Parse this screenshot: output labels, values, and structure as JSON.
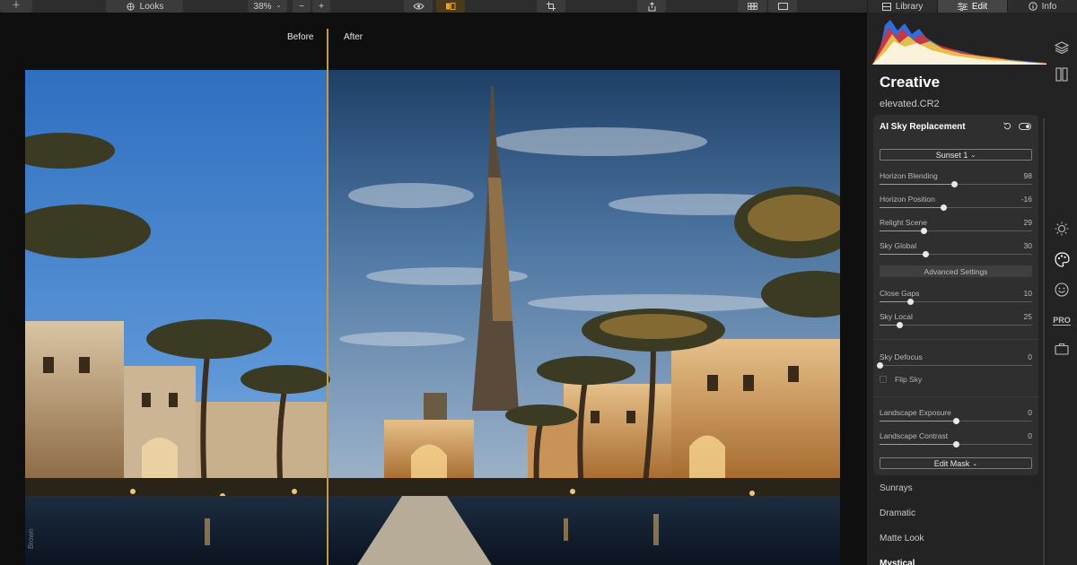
{
  "toolbar": {
    "add_icon": "plus-icon",
    "looks_label": "Looks",
    "zoom": "38%",
    "zoom_out": "−",
    "zoom_in": "+",
    "preview_icon": "eye-icon",
    "compare_icon": "split-compare-icon",
    "crop_icon": "crop-icon",
    "share_icon": "share-icon",
    "grid_icon": "grid-icon",
    "single_icon": "single-view-icon"
  },
  "tabs": [
    {
      "label": "Library",
      "icon": "library-icon"
    },
    {
      "label": "Edit",
      "icon": "sliders-icon"
    },
    {
      "label": "Info",
      "icon": "info-icon"
    }
  ],
  "canvas": {
    "before_label": "Before",
    "after_label": "After",
    "watermark": "Brown"
  },
  "panel": {
    "section_title": "Creative",
    "file_name": "elevated.CR2",
    "tool_card": {
      "title": "AI Sky Replacement",
      "preset": "Sunset 1",
      "sliders_top": [
        {
          "label": "Horizon Blending",
          "value": "98",
          "pos": 0.49
        },
        {
          "label": "Horizon Position",
          "value": "-16",
          "pos": 0.42
        },
        {
          "label": "Relight Scene",
          "value": "29",
          "pos": 0.29
        },
        {
          "label": "Sky Global",
          "value": "30",
          "pos": 0.3
        }
      ],
      "advanced_label": "Advanced Settings",
      "sliders_adv": [
        {
          "label": "Close Gaps",
          "value": "10",
          "pos": 0.2
        },
        {
          "label": "Sky Local",
          "value": "25",
          "pos": 0.13
        }
      ],
      "sliders_defocus": [
        {
          "label": "Sky Defocus",
          "value": "0",
          "pos": 0.0
        }
      ],
      "flip_sky_label": "Flip Sky",
      "sliders_landscape": [
        {
          "label": "Landscape Exposure",
          "value": "0",
          "pos": 0.5
        },
        {
          "label": "Landscape Contrast",
          "value": "0",
          "pos": 0.5
        }
      ],
      "edit_mask_label": "Edit Mask"
    },
    "tools": [
      "Sunrays",
      "Dramatic",
      "Matte Look",
      "Mystical"
    ],
    "side_icons": [
      "layers-icon",
      "compare-panels-icon",
      "sun-icon",
      "palette-icon",
      "smiley-icon",
      "pro-icon",
      "briefcase-icon"
    ],
    "pro_label": "PRO"
  }
}
